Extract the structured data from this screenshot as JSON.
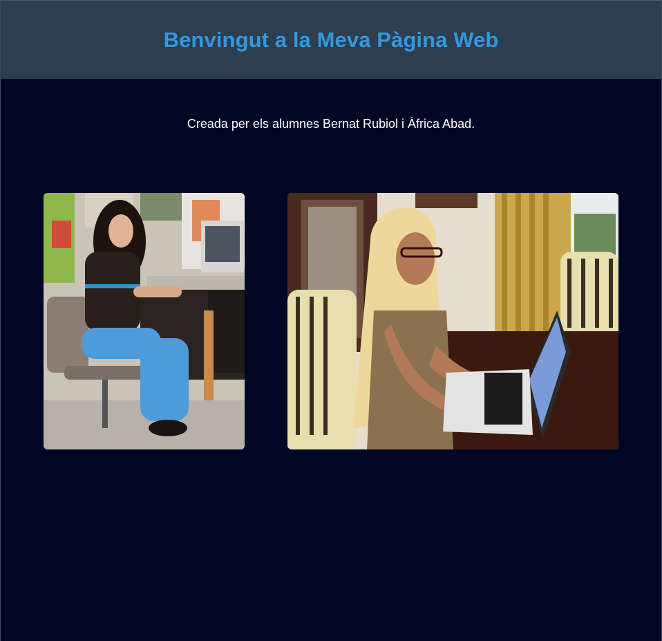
{
  "header": {
    "title": "Benvingut a la Meva Pàgina Web"
  },
  "intro": {
    "text": "Creada per els alumnes Bernat Rubiol i Àfrica Abad."
  },
  "colors": {
    "background": "#010625",
    "header_bg": "#2c3e50",
    "title": "#3498db",
    "text": "#ffffff"
  },
  "gallery": [
    {
      "subject": "girl-at-computer-photo"
    },
    {
      "subject": "woman-at-laptop-photo"
    }
  ]
}
